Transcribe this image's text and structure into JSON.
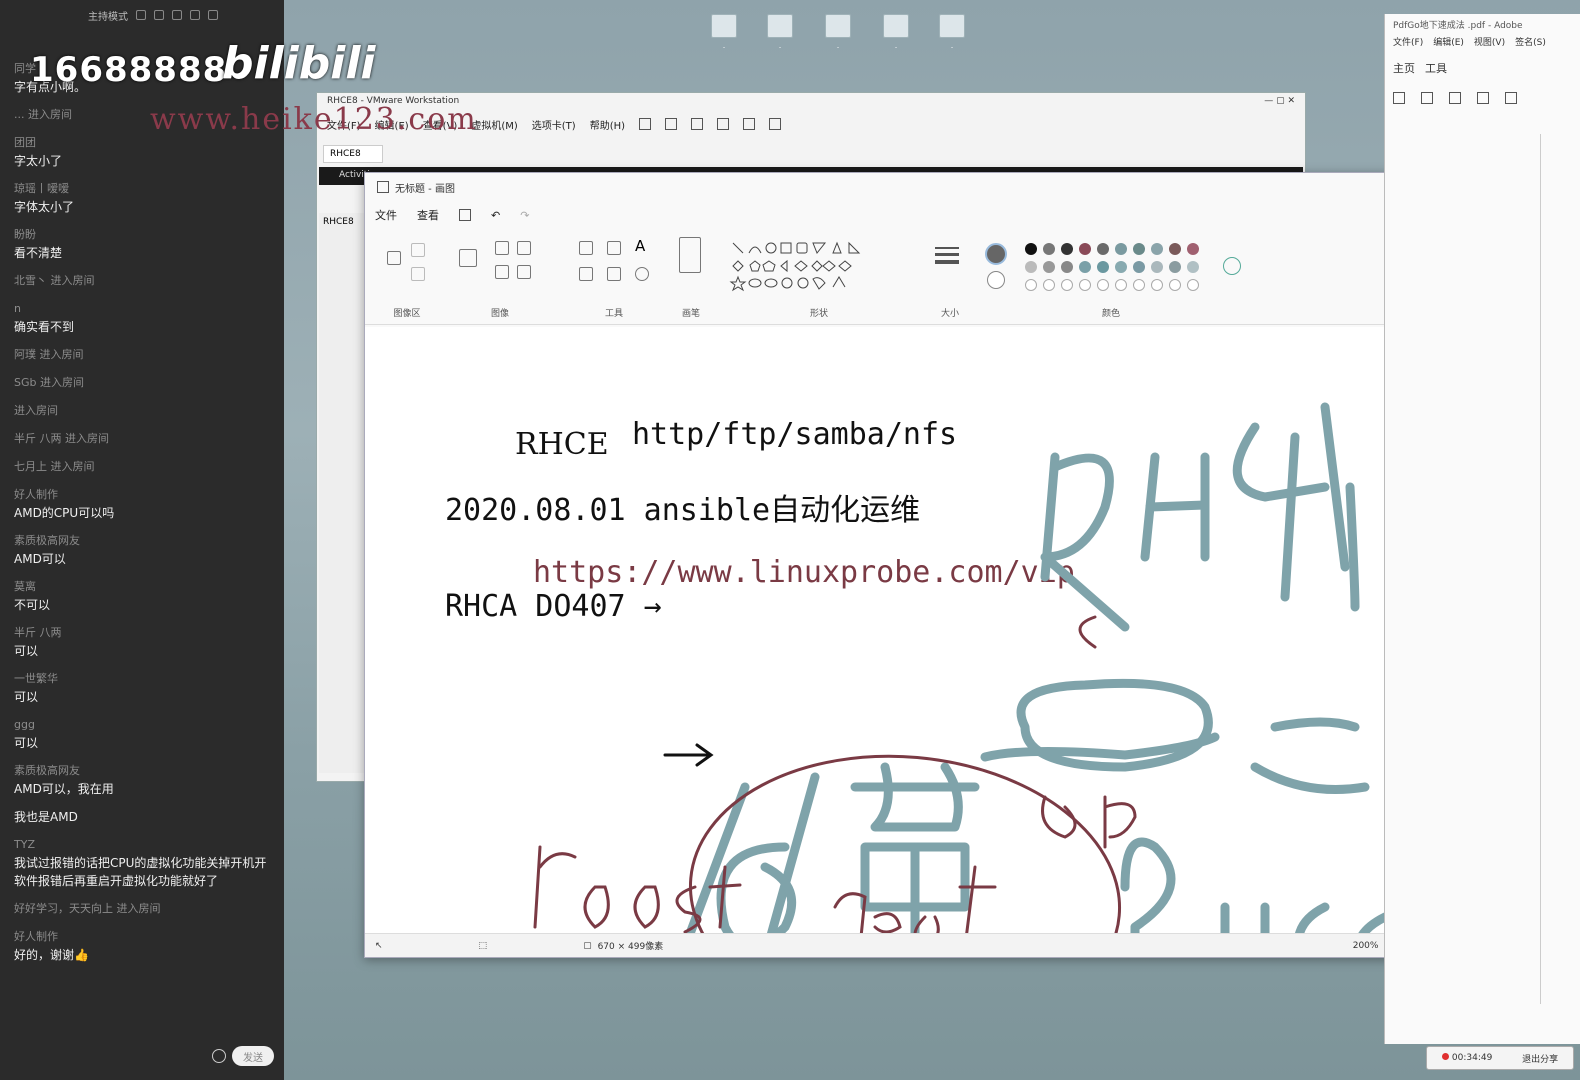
{
  "watermark": {
    "number": "16688888",
    "brand": "bilibili",
    "site": "www.heike123.com"
  },
  "chat": {
    "title": "主持模式",
    "messages": [
      {
        "user": "同学",
        "text": "字有点小啊。"
      },
      {
        "user": "",
        "enter": "... 进入房间"
      },
      {
        "user": "团团",
        "text": "字太小了"
      },
      {
        "user": "琼瑶丨嗳嗳",
        "text": "字体太小了"
      },
      {
        "user": "盼盼",
        "text": "看不清楚"
      },
      {
        "user": "",
        "enter": "北雪丶 进入房间"
      },
      {
        "user": "n",
        "text": "确实看不到"
      },
      {
        "user": "",
        "enter": "阿璞 进入房间"
      },
      {
        "user": "",
        "enter": "SGb 进入房间"
      },
      {
        "user": "",
        "enter": "进入房间"
      },
      {
        "user": "",
        "enter": "半斤 八两 进入房间"
      },
      {
        "user": "",
        "enter": "七月上 进入房间"
      },
      {
        "user": "好人制作",
        "text": "AMD的CPU可以吗"
      },
      {
        "user": "素质极高网友",
        "text": "AMD可以"
      },
      {
        "user": "莫离",
        "text": "不可以"
      },
      {
        "user": "半斤 八两",
        "text": "可以"
      },
      {
        "user": "一世繁华",
        "text": "可以"
      },
      {
        "user": "ggg",
        "text": "可以"
      },
      {
        "user": "素质极高网友",
        "text": "AMD可以，我在用"
      },
      {
        "user": "",
        "text": "我也是AMD"
      },
      {
        "user": "TYZ",
        "text": "我试过报错的话把CPU的虚拟化功能关掉开机开软件报错后再重启开虚拟化功能就好了"
      },
      {
        "user": "",
        "enter": "好好学习，天天向上 进入房间"
      },
      {
        "user": "好人制作",
        "text": "好的，谢谢👍"
      }
    ],
    "send_label": "发送"
  },
  "vmware": {
    "title": "RHCE8 - VMware Workstation",
    "menu": [
      "文件(F)",
      "编辑(E)",
      "查看(V)",
      "虚拟机(M)",
      "选项卡(T)",
      "帮助(H)"
    ],
    "tab": "RHCE8",
    "activities": "Activities",
    "side_label": "RHCE8"
  },
  "paint": {
    "title": "无标题 - 画图",
    "menu": [
      "文件",
      "查看"
    ],
    "groups": [
      "图像区",
      "图像",
      "工具",
      "画笔",
      "形状",
      "大小",
      "颜色"
    ],
    "status_size": "670 × 499像素",
    "zoom": "200%"
  },
  "canvas_text": {
    "line1a": "RHCE",
    "line1b": "http/ftp/samba/nfs",
    "line2": "2020.08.01  ansible自动化运维",
    "line3": "https://www.linuxprobe.com/vip",
    "line4": "RHCA DO407 →"
  },
  "pdf": {
    "title": "PdfGo地下速成法 .pdf - Adobe",
    "menu": [
      "文件(F)",
      "编辑(E)",
      "视图(V)",
      "签名(S)"
    ],
    "tabs": [
      "主页",
      "工具"
    ]
  },
  "live": {
    "time": "00:34:49",
    "stop": "退出分享"
  }
}
